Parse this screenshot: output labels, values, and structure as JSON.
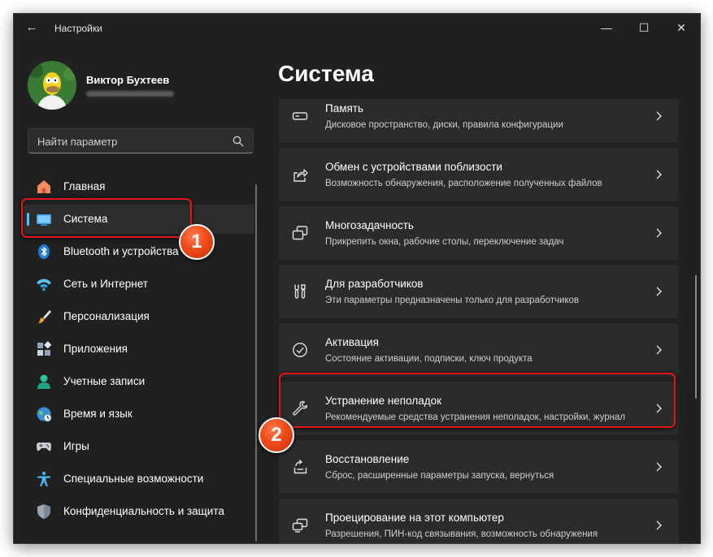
{
  "window": {
    "title": "Настройки",
    "back_icon": "←",
    "controls": {
      "minimize": "—",
      "maximize": "☐",
      "close": "✕"
    }
  },
  "user": {
    "name": "Виктор Бухтеев"
  },
  "search": {
    "placeholder": "Найти параметр"
  },
  "sidebar": {
    "items": [
      {
        "label": "Главная",
        "icon": "home-icon"
      },
      {
        "label": "Система",
        "icon": "system-icon",
        "active": true
      },
      {
        "label": "Bluetooth и устройства",
        "icon": "bluetooth-icon"
      },
      {
        "label": "Сеть и Интернет",
        "icon": "wifi-icon"
      },
      {
        "label": "Персонализация",
        "icon": "brush-icon"
      },
      {
        "label": "Приложения",
        "icon": "apps-icon"
      },
      {
        "label": "Учетные записи",
        "icon": "account-icon"
      },
      {
        "label": "Время и язык",
        "icon": "globe-icon"
      },
      {
        "label": "Игры",
        "icon": "gamepad-icon"
      },
      {
        "label": "Специальные возможности",
        "icon": "accessibility-icon"
      },
      {
        "label": "Конфиденциальность и защита",
        "icon": "shield-icon"
      }
    ]
  },
  "main": {
    "title": "Система",
    "cards": [
      {
        "title": "Память",
        "subtitle": "Дисковое пространство, диски, правила конфигурации",
        "icon": "storage-icon"
      },
      {
        "title": "Обмен с устройствами поблизости",
        "subtitle": "Возможность обнаружения, расположение полученных файлов",
        "icon": "share-icon"
      },
      {
        "title": "Многозадачность",
        "subtitle": "Прикрепить окна, рабочие столы, переключение задач",
        "icon": "multitask-icon"
      },
      {
        "title": "Для разработчиков",
        "subtitle": "Эти параметры предназначены только для разработчиков",
        "icon": "tools-icon"
      },
      {
        "title": "Активация",
        "subtitle": "Состояние активации, подписки, ключ продукта",
        "icon": "check-circle-icon"
      },
      {
        "title": "Устранение неполадок",
        "subtitle": "Рекомендуемые средства устранения неполадок, настройки, журнал",
        "icon": "wrench-icon"
      },
      {
        "title": "Восстановление",
        "subtitle": "Сброс, расширенные параметры запуска, вернуться",
        "icon": "recovery-icon"
      },
      {
        "title": "Проецирование на этот компьютер",
        "subtitle": "Разрешения, ПИН-код связывания, возможность обнаружения",
        "icon": "project-icon"
      }
    ]
  },
  "annotations": {
    "badge_1": "1",
    "badge_2": "2"
  },
  "colors": {
    "accent": "#4cc2ff",
    "highlight": "#e4141b",
    "badge": "#ee4a18",
    "window_bg": "#202020",
    "card_bg": "#2b2b2b"
  }
}
